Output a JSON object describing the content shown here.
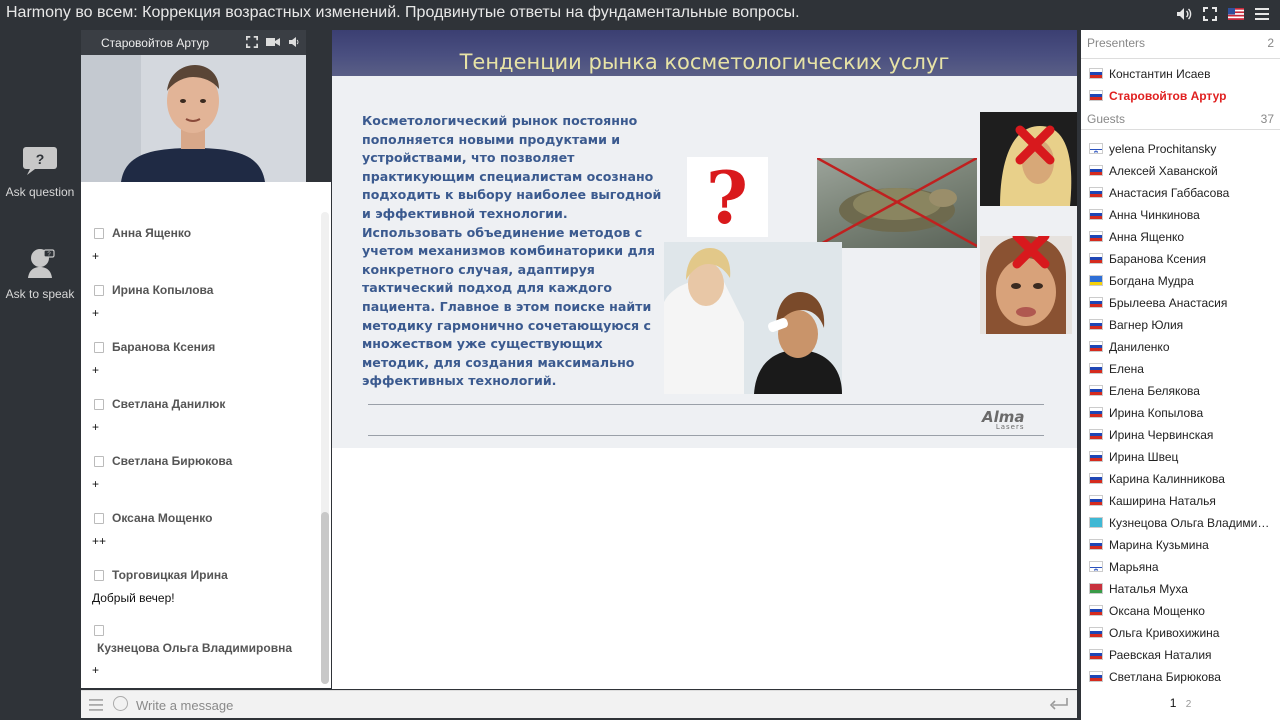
{
  "window": {
    "title": "Harmony во всем: Коррекция возрастных изменений. Продвинутые ответы на фундаментальные вопросы."
  },
  "rail": {
    "ask_question": "Ask question",
    "ask_to_speak": "Ask to speak"
  },
  "video": {
    "presenter_name": "Старовойтов Артур"
  },
  "chat": {
    "messages": [
      {
        "author": "Анна Ященко",
        "text": "+"
      },
      {
        "author": "Ирина Копылова",
        "text": "+"
      },
      {
        "author": "Баранова Ксения",
        "text": "+"
      },
      {
        "author": "Светлана Данилюк",
        "text": "+"
      },
      {
        "author": "Светлана Бирюкова",
        "text": "+"
      },
      {
        "author": "Оксана Мощенко",
        "text": "++"
      },
      {
        "author": "Торговицкая Ирина",
        "text": "Добрый вечер!"
      },
      {
        "author": "Кузнецова Ольга Владимировна",
        "text": "+"
      }
    ],
    "input_placeholder": "Write a message"
  },
  "slide": {
    "title": "Тенденции рынка косметологических услуг",
    "body": "Косметологический  рынок постоянно пополняется новыми продуктами и устройствами, что позволяет практикующим специалистам осознано подходить к выбору наиболее выгодной и эффективной технологии. Использовать объединение методов с учетом механизмов комбинаторики  для конкретного случая, адаптируя тактический подход для каждого пациента. Главное в этом поиске найти методику гармонично сочетающуюся с множеством уже существующих методик, для создания максимально эффективных технологий.",
    "logo": "Alma",
    "logo_sub": "Lasers"
  },
  "users": {
    "presenters_label": "Presenters",
    "presenters_count": "2",
    "guests_label": "Guests",
    "guests_count": "37",
    "presenters": [
      {
        "name": "Константин Исаев",
        "flag": "ru",
        "active": false
      },
      {
        "name": "Старовойтов Артур",
        "flag": "ru",
        "active": true
      }
    ],
    "guests": [
      {
        "name": "yelena Prochitansky",
        "flag": "il"
      },
      {
        "name": "Алексей Хаванской",
        "flag": "ru"
      },
      {
        "name": "Анастасия Габбасова",
        "flag": "ru"
      },
      {
        "name": "Анна Чинкинова",
        "flag": "ru"
      },
      {
        "name": "Анна Ященко",
        "flag": "ru"
      },
      {
        "name": "Баранова Ксения",
        "flag": "ru"
      },
      {
        "name": "Богдана Мудра",
        "flag": "ua"
      },
      {
        "name": "Брылеева Анастасия",
        "flag": "ru"
      },
      {
        "name": "Вагнер Юлия",
        "flag": "ru"
      },
      {
        "name": "Даниленко",
        "flag": "ru"
      },
      {
        "name": "Елена",
        "flag": "ru"
      },
      {
        "name": "Елена Белякова",
        "flag": "ru"
      },
      {
        "name": "Ирина Копылова",
        "flag": "ru"
      },
      {
        "name": "Ирина Червинская",
        "flag": "ru"
      },
      {
        "name": "Ирина Швец",
        "flag": "ru"
      },
      {
        "name": "Карина Калинникова",
        "flag": "ru"
      },
      {
        "name": "Каширина Наталья",
        "flag": "ru"
      },
      {
        "name": "Кузнецова Ольга Владимировна",
        "flag": "kz"
      },
      {
        "name": "Марина Кузьмина",
        "flag": "ru"
      },
      {
        "name": "Марьяна",
        "flag": "il"
      },
      {
        "name": "Наталья Муха",
        "flag": "by"
      },
      {
        "name": "Оксана Мощенко",
        "flag": "ru"
      },
      {
        "name": "Ольга Кривохижина",
        "flag": "ru"
      },
      {
        "name": "Раевская Наталия",
        "flag": "ru"
      },
      {
        "name": "Светлана Бирюкова",
        "flag": "ru"
      }
    ],
    "pages": [
      "1",
      "2"
    ]
  },
  "colors": {
    "accent_red": "#e02020",
    "slide_text": "#3b5a8f",
    "slide_title": "#e7e3a6"
  },
  "icons": [
    "volume-icon",
    "fullscreen-icon",
    "us-flag-icon",
    "hamburger-menu-icon",
    "question-icon",
    "hand-raise-icon",
    "camera-icon",
    "speaker-icon",
    "smile-icon",
    "enter-icon"
  ]
}
